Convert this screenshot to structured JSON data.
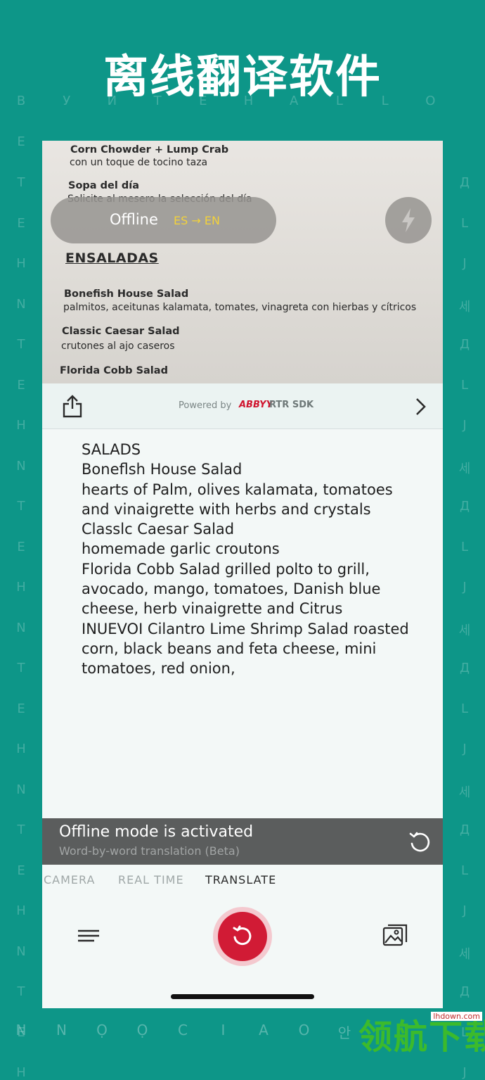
{
  "headline": "离线翻译软件",
  "background_letters": {
    "left": [
      "T",
      "E",
      "H",
      "N",
      "T",
      "E",
      "H",
      "N",
      "T",
      "E",
      "H",
      "N",
      "T",
      "E",
      "H",
      "N",
      "T",
      "E",
      "H",
      "N",
      "T",
      "E",
      "H"
    ],
    "right": [
      "Д",
      "L",
      "J",
      "세",
      "Д",
      "L",
      "J",
      "세",
      "Д",
      "L",
      "J",
      "세",
      "Д",
      "L",
      "J",
      "세",
      "Д",
      "L",
      "J",
      "세",
      "Д",
      "L",
      "J"
    ],
    "top_row": [
      "B",
      "У",
      "И",
      "T",
      "E",
      "H",
      "A",
      "L",
      "L",
      "O"
    ],
    "bottom_row": [
      "N",
      "N",
      "Ọ",
      "Ọ",
      "C",
      "I",
      "A",
      "O",
      "안"
    ]
  },
  "camera": {
    "menu_lines": [
      "Corn Chowder + Lump Crab",
      "con un toque de tocino taza",
      "Sopa del día",
      "Solicite al mesero la selección del día",
      "ENSALADAS",
      "Bonefish House Salad",
      "palmitos, aceitunas kalamata, tomates, vinagreta con hierbas y cítricos",
      "Classic Caesar Salad",
      "crutones al ajo caseros",
      "Florida Cobb Salad"
    ],
    "mode_label": "Offline",
    "language_pair": "ES → EN",
    "flash_icon": "flash-icon"
  },
  "toolbar": {
    "powered_by": "Powered by",
    "brand": "ABBYY",
    "sdk": "RTR SDK"
  },
  "result_lines": [
    "SALADS",
    "Boneflsh House Salad",
    "hearts of Palm, olives kalamata, tomatoes",
    "and vinaigrette with herbs and crystals",
    "Classlc Caesar Salad",
    "homemade garlic croutons",
    "Florida Cobb Salad grilled polto to grill,",
    "avocado, mango, tomatoes, Danish blue",
    "cheese, herb vinaigrette and Citrus",
    "INUEVOI Cilantro Lime Shrimp Salad roasted",
    "corn, black beans and feta cheese, mini",
    "tomatoes, red onion,"
  ],
  "banner": {
    "title": "Offline mode is activated",
    "subtitle": "Word-by-word translation (Beta)"
  },
  "tabs": [
    "CAMERA",
    "REAL TIME",
    "TRANSLATE"
  ],
  "active_tab": "TRANSLATE",
  "watermark": {
    "text": "领航下载",
    "url": "lhdown.com"
  },
  "colors": {
    "background": "#0d9688",
    "accent_red": "#d11b35",
    "language_yellow": "#f3d23a"
  }
}
